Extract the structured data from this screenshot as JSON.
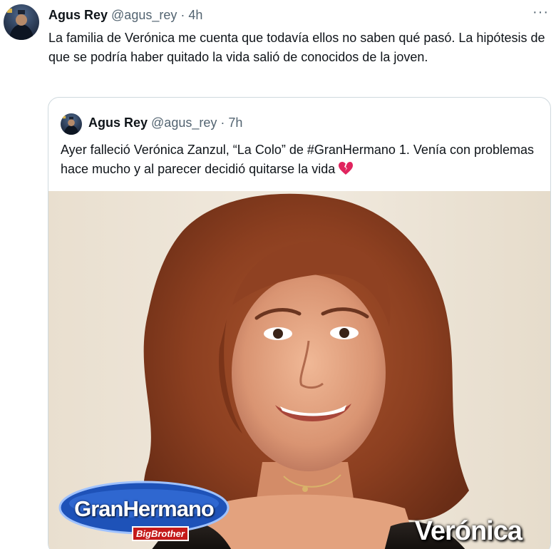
{
  "tweet": {
    "author_name": "Agus Rey",
    "author_handle": "@agus_rey",
    "separator": " · ",
    "time": "4h",
    "more_label": "···",
    "avatar_icon": "profile-avatar",
    "text": "La familia de Verónica me cuenta que todavía ellos no saben qué pasó. La hipótesis de que se podría haber quitado la vida salió de conocidos de la joven."
  },
  "quoted_tweet": {
    "author_name": "Agus Rey",
    "author_handle": "@agus_rey",
    "separator": " · ",
    "time": "7h",
    "avatar_icon": "profile-avatar",
    "text": "Ayer falleció Verónica Zanzul, “La Colo” de #GranHermano 1. Venía con problemas hace mucho y al parecer decidió quitarse la vida",
    "emoji_icon": "broken-heart-icon",
    "image": {
      "description_icon": "portrait-photo",
      "logo_text": "GranHermano",
      "logo_subtext": "BigBrother",
      "caption": "Verónica"
    }
  },
  "colors": {
    "text_primary": "#0f1419",
    "text_secondary": "#536471",
    "border": "#cfd9de",
    "broken_heart": "#e0245e"
  }
}
